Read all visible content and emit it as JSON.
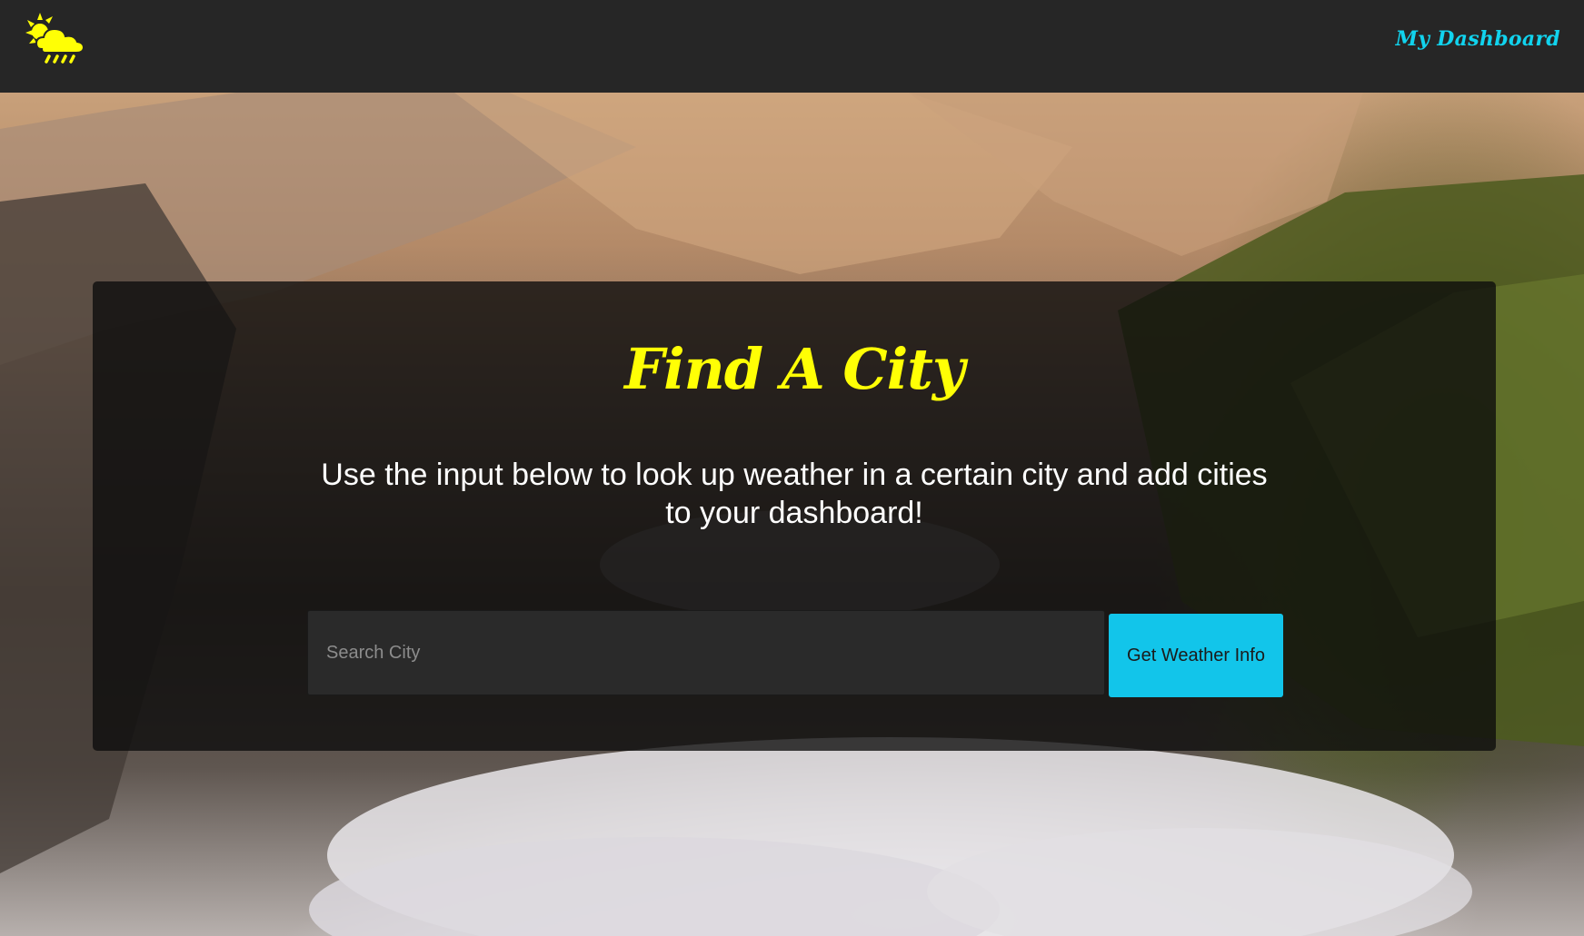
{
  "navbar": {
    "logo_icon": "weather-sun-cloud-rain-icon",
    "dashboard_link": "My Dashboard"
  },
  "main": {
    "title": "Find A City",
    "subtitle": "Use the input below to look up weather in a certain city and add cities to your dashboard!",
    "search": {
      "placeholder": "Search City",
      "value": ""
    },
    "button_label": "Get Weather Info"
  },
  "colors": {
    "navbar_bg": "#262626",
    "accent_yellow": "#ffff05",
    "accent_cyan": "#11d3ee",
    "button_bg": "#12c5ea"
  }
}
